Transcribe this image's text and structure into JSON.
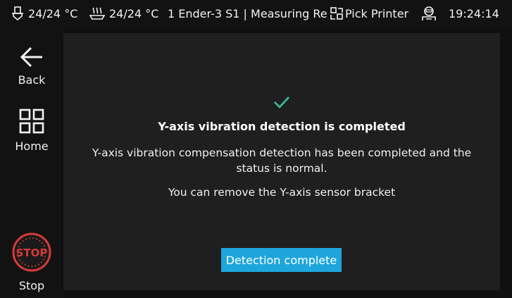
{
  "status_bar": {
    "nozzle_temp": "24/24 °C",
    "bed_temp": "24/24 °C",
    "printer_status": "1 Ender-3 S1 | Measuring Re",
    "pick_printer_label": "Pick Printer",
    "time": "19:24:14",
    "icons": [
      "nozzle-icon",
      "bed-heat-icon",
      "pick-printer-icon",
      "user-icon"
    ]
  },
  "sidebar": {
    "back_label": "Back",
    "home_label": "Home",
    "stop_label": "Stop",
    "stop_badge": "STOP",
    "icons": [
      "back-arrow-icon",
      "home-grid-icon",
      "stop-icon"
    ]
  },
  "dialog": {
    "icon": "checkmark-icon",
    "title": "Y-axis vibration detection is completed",
    "message": "Y-axis vibration compensation detection has been completed and the status is normal.",
    "hint": "You can remove the Y-axis sensor bracket",
    "button_label": "Detection complete"
  },
  "colors": {
    "accent": "#1ea6dc",
    "check": "#3fbf9f",
    "stop": "#d83a3a",
    "panel_bg": "#1f1f1f",
    "bg": "#121212"
  }
}
